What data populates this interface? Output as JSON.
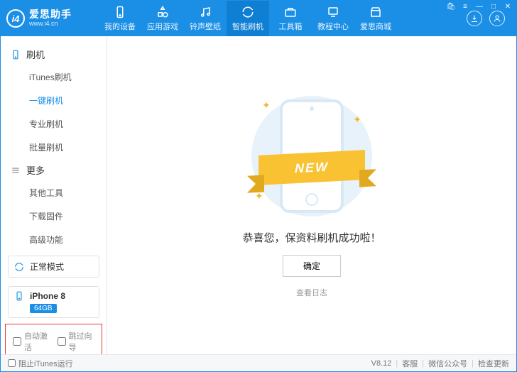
{
  "logo": {
    "badge": "i4",
    "title": "爱思助手",
    "url": "www.i4.cn"
  },
  "tabs": [
    {
      "label": "我的设备",
      "icon": "device"
    },
    {
      "label": "应用游戏",
      "icon": "apps"
    },
    {
      "label": "铃声壁纸",
      "icon": "music"
    },
    {
      "label": "智能刷机",
      "icon": "refresh",
      "active": true
    },
    {
      "label": "工具箱",
      "icon": "toolbox"
    },
    {
      "label": "教程中心",
      "icon": "tutorial"
    },
    {
      "label": "爱思商城",
      "icon": "store"
    }
  ],
  "sidebar": {
    "group1": {
      "title": "刷机",
      "items": [
        "iTunes刷机",
        "一键刷机",
        "专业刷机",
        "批量刷机"
      ],
      "activeIndex": 1
    },
    "group2": {
      "title": "更多",
      "items": [
        "其他工具",
        "下载固件",
        "高级功能"
      ]
    }
  },
  "mode": {
    "label": "正常模式"
  },
  "device": {
    "name": "iPhone 8",
    "storage": "64GB"
  },
  "checks": {
    "autoActivate": "自动激活",
    "skipGuide": "跳过向导"
  },
  "main": {
    "ribbon": "NEW",
    "message": "恭喜您，保资料刷机成功啦！",
    "ok": "确定",
    "viewLog": "查看日志"
  },
  "footer": {
    "preventItunes": "阻止iTunes运行",
    "version": "V8.12",
    "support": "客服",
    "wechat": "微信公众号",
    "update": "检查更新"
  }
}
